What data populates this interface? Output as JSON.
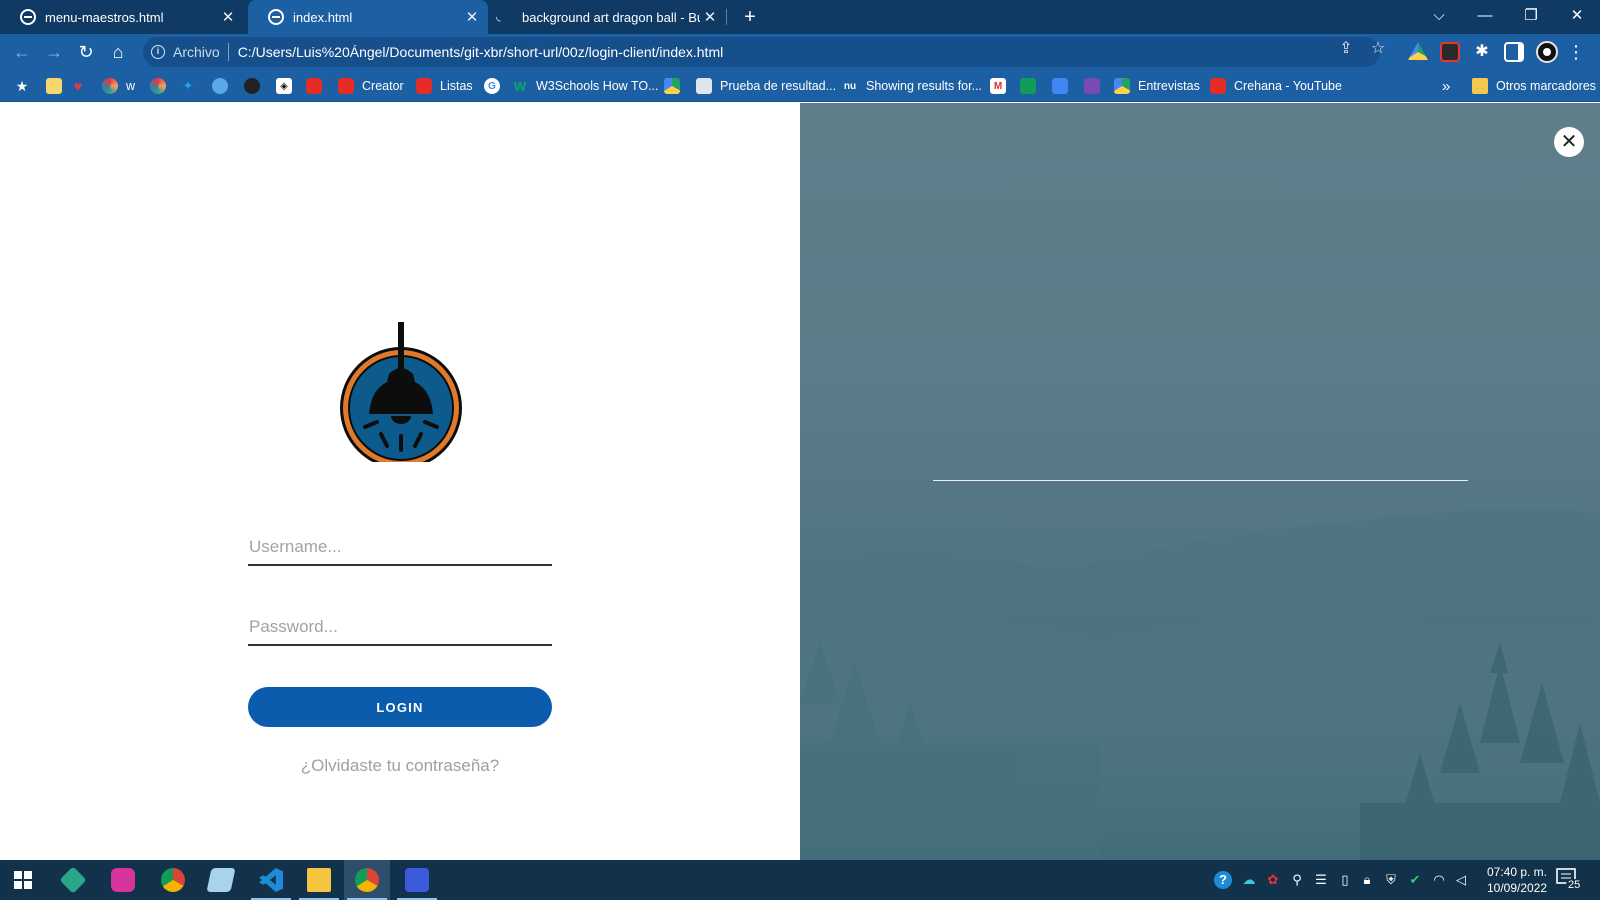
{
  "browser": {
    "tabs": [
      {
        "title": "menu-maestros.html",
        "active": false
      },
      {
        "title": "index.html",
        "active": true
      },
      {
        "title": "background art dragon ball - Bús",
        "active": false
      }
    ],
    "tab_close_glyph": "✕",
    "new_tab_glyph": "+",
    "window_controls": {
      "tab_search": "⌵",
      "minimize": "—",
      "restore": "❐",
      "close": "✕"
    },
    "address_bar": {
      "scheme_label": "Archivo",
      "url": "C:/Users/Luis%20Ángel/Documents/git-xbr/short-url/00z/login-client/index.html"
    },
    "nav": {
      "back": "←",
      "forward": "→",
      "reload": "↻",
      "home": "⌂"
    },
    "bookmarks": [
      {
        "label": "",
        "icon": "star-icon"
      },
      {
        "label": "",
        "icon": "note-icon"
      },
      {
        "label": "",
        "icon": "heart-icon"
      },
      {
        "label": "w",
        "icon": "colorwheel-icon"
      },
      {
        "label": "",
        "icon": "colorwheel-icon"
      },
      {
        "label": "",
        "icon": "twitter-icon"
      },
      {
        "label": "",
        "icon": "sync-icon"
      },
      {
        "label": "",
        "icon": "github-icon"
      },
      {
        "label": "",
        "icon": "codepen-icon"
      },
      {
        "label": "",
        "icon": "youtube-icon"
      },
      {
        "label": "Creator",
        "icon": "youtube-icon"
      },
      {
        "label": "Listas",
        "icon": "youtube-icon"
      },
      {
        "label": "",
        "icon": "google-icon"
      },
      {
        "label": "W3Schools How TO...",
        "icon": "w3schools-icon"
      },
      {
        "label": "",
        "icon": "drive-icon"
      },
      {
        "label": "Prueba de resultad...",
        "icon": "car-icon"
      },
      {
        "label": "Showing results for...",
        "icon": "nu-icon"
      },
      {
        "label": "",
        "icon": "gmail-icon"
      },
      {
        "label": "",
        "icon": "sheets-icon"
      },
      {
        "label": "",
        "icon": "docs-icon"
      },
      {
        "label": "",
        "icon": "forms-icon"
      },
      {
        "label": "Entrevistas",
        "icon": "drive-icon"
      },
      {
        "label": "Crehana - YouTube",
        "icon": "youtube-icon"
      }
    ],
    "bookmarks_overflow": "»",
    "other_bookmarks": "Otros marcadores"
  },
  "login": {
    "username_placeholder": "Username...",
    "password_placeholder": "Password...",
    "login_label": "LOGIN",
    "forgot_label": "¿Olvidaste tu contraseña?"
  },
  "right_panel": {
    "close_glyph": "✕"
  },
  "taskbar": {
    "apps": [
      "windows-start-icon",
      "minecraft-launcher-icon",
      "figma-like-icon",
      "chrome-icon",
      "notepad-icon",
      "vscode-icon",
      "file-explorer-icon",
      "chrome-profile-icon",
      "snipping-tool-icon"
    ],
    "clock_time": "07:40 p. m.",
    "clock_date": "10/09/2022",
    "notification_count": "25"
  },
  "colors": {
    "tabstrip": "#0e3a64",
    "toolbar": "#1c5fa3",
    "login_button": "#0b5cad",
    "logo_ring": "#e07a2a",
    "logo_fill": "#0d5b8c",
    "taskbar": "#11324a"
  }
}
